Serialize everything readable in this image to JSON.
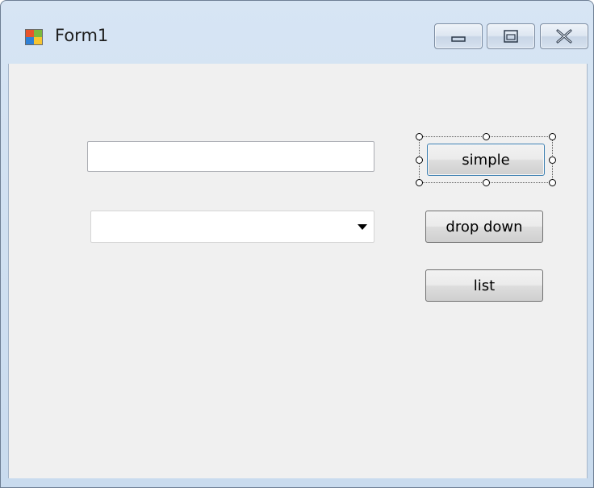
{
  "window": {
    "title": "Form1",
    "icon": "windows-forms-app-icon"
  },
  "caption_buttons": {
    "minimize": "minimize-icon",
    "maximize": "maximize-icon",
    "close": "close-icon"
  },
  "form": {
    "textbox_value": "",
    "combobox_value": "",
    "combobox_arrow": "dropdown-arrow-icon",
    "buttons": {
      "simple": "simple",
      "drop_down": "drop down",
      "list": "list"
    },
    "selected_control": "simple"
  },
  "colors": {
    "frame": "#d7e5f4",
    "client": "#f0f0f0",
    "selection_handles": "#000000"
  }
}
